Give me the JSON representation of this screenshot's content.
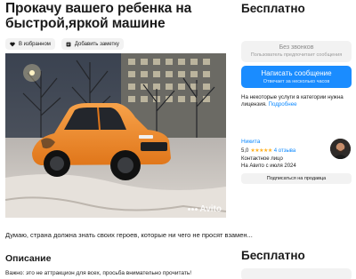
{
  "listing": {
    "title": "Прокачу вашего ребенка на быстрой,яркой машине",
    "favorite_label": "В избранном",
    "note_label": "Добавить заметку",
    "photo_watermark": "Avito",
    "quote": "Думаю, страна должна знать своих героев, которые ни чего не просят взамен...",
    "description_heading": "Описание",
    "description_text": "Важно: это не аттракцион для всех, просьба внимательно прочитать!"
  },
  "sidebar": {
    "price": "Бесплатно",
    "no_calls_title": "Без звонков",
    "no_calls_sub": "Пользователь предпочитает сообщения",
    "message_button": "Написать сообщение",
    "message_button_sub": "Отвечает за несколько часов",
    "license_text": "На некоторые услуги в категории нужна лицензия.",
    "license_link": "Подробнее",
    "seller_name": "Никита",
    "rating_value": "5,0",
    "rating_stars": "★★★★★",
    "rating_reviews": "4 отзыва",
    "seller_type": "Контактное лицо",
    "seller_since": "На Авито с июля 2024",
    "subscribe_button": "Подписаться на продавца",
    "price_repeat": "Бесплатно"
  },
  "colors": {
    "accent_blue": "#1a8cff",
    "link_blue": "#0a88ff",
    "star_color": "#ffb021",
    "car_orange": "#f28a1e"
  }
}
